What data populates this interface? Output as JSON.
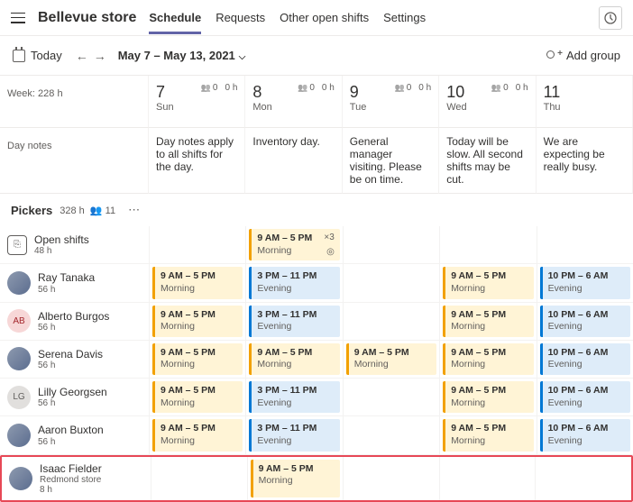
{
  "header": {
    "store_name": "Bellevue store",
    "tabs": [
      "Schedule",
      "Requests",
      "Other open shifts",
      "Settings"
    ],
    "active_tab": 0
  },
  "toolbar": {
    "today_label": "Today",
    "date_range": "May 7 – May 13, 2021",
    "add_group_label": "Add group"
  },
  "week_summary": {
    "label": "Week:",
    "hours": "228 h"
  },
  "days": [
    {
      "num": "7",
      "name": "Sun",
      "people": "0",
      "hours": "0 h",
      "note": "Day notes apply to all shifts for the day."
    },
    {
      "num": "8",
      "name": "Mon",
      "people": "0",
      "hours": "0 h",
      "note": "Inventory day."
    },
    {
      "num": "9",
      "name": "Tue",
      "people": "0",
      "hours": "0 h",
      "note": "General manager visiting. Please be on time."
    },
    {
      "num": "10",
      "name": "Wed",
      "people": "0",
      "hours": "0 h",
      "note": "Today will be slow. All second shifts may be cut."
    },
    {
      "num": "11",
      "name": "Thu",
      "people": "",
      "hours": "",
      "note": "We are expecting be really busy."
    }
  ],
  "day_notes_label": "Day notes",
  "group": {
    "name": "Pickers",
    "hours": "328 h",
    "people": "11"
  },
  "open_shifts": {
    "label": "Open shifts",
    "hours": "48 h"
  },
  "people": [
    {
      "name": "Ray Tanaka",
      "hours": "56 h",
      "avatar": "photo"
    },
    {
      "name": "Alberto Burgos",
      "hours": "56 h",
      "avatar": "ab",
      "initials": "AB"
    },
    {
      "name": "Serena Davis",
      "hours": "56 h",
      "avatar": "photo"
    },
    {
      "name": "Lilly Georgsen",
      "hours": "56 h",
      "avatar": "lg",
      "initials": "LG"
    },
    {
      "name": "Aaron Buxton",
      "hours": "56 h",
      "avatar": "photo"
    },
    {
      "name": "Isaac Fielder",
      "hours": "8 h",
      "subtitle": "Redmond store",
      "avatar": "photo"
    }
  ],
  "shift_types": {
    "morning": {
      "time": "9 AM – 5 PM",
      "label": "Morning"
    },
    "evening_3": {
      "time": "3 PM – 11 PM",
      "label": "Evening"
    },
    "evening_10": {
      "time": "10 PM – 6 AM",
      "label": "Evening"
    }
  },
  "open_shift_card": {
    "time": "9 AM – 5 PM",
    "label": "Morning",
    "count": "×3"
  },
  "schedule": {
    "ray": [
      "morning",
      "evening_3",
      null,
      "morning",
      "evening_10"
    ],
    "alberto": [
      "morning",
      "evening_3",
      null,
      "morning",
      "evening_10"
    ],
    "serena": [
      "morning",
      "morning",
      "morning",
      "morning",
      "evening_10"
    ],
    "lilly": [
      "morning",
      "evening_3",
      null,
      "morning",
      "evening_10"
    ],
    "aaron": [
      "morning",
      "evening_3",
      null,
      "morning",
      "evening_10"
    ],
    "isaac": [
      null,
      "morning",
      null,
      null,
      null
    ]
  }
}
